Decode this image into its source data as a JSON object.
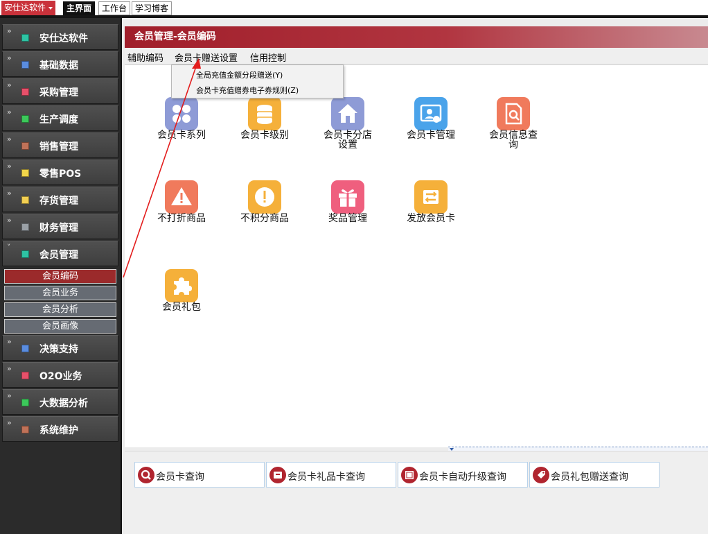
{
  "topbar": {
    "app_menu": "安仕达软件",
    "tabs": [
      "主界面",
      "工作台",
      "学习博客"
    ]
  },
  "sidebar": {
    "items": [
      {
        "label": "安仕达软件",
        "icon": "teal-square-icon",
        "color": "#2ec4a4"
      },
      {
        "label": "基础数据",
        "icon": "blue-square-icon",
        "color": "#5a8de0"
      },
      {
        "label": "采购管理",
        "icon": "pink-square-icon",
        "color": "#e8506a"
      },
      {
        "label": "生产调度",
        "icon": "green-square-icon",
        "color": "#3cc85a"
      },
      {
        "label": "销售管理",
        "icon": "brown-square-icon",
        "color": "#c07258"
      },
      {
        "label": "零售POS",
        "icon": "yellow-square-icon",
        "color": "#f2d64a"
      },
      {
        "label": "存货管理",
        "icon": "yellow-square-icon",
        "color": "#f2cf52"
      },
      {
        "label": "财务管理",
        "icon": "gray-square-icon",
        "color": "#9aa0a6"
      },
      {
        "label": "会员管理",
        "icon": "teal-square-icon",
        "color": "#2ec4a4",
        "expanded": true
      },
      {
        "label": "决策支持",
        "icon": "blue-square-icon",
        "color": "#5a8de0"
      },
      {
        "label": "O2O业务",
        "icon": "pink-square-icon",
        "color": "#e8506a"
      },
      {
        "label": "大数据分析",
        "icon": "green-square-icon",
        "color": "#3cc85a"
      },
      {
        "label": "系统维护",
        "icon": "brown-square-icon",
        "color": "#c07258"
      }
    ],
    "sub_items": [
      "会员编码",
      "会员业务",
      "会员分析",
      "会员画像"
    ]
  },
  "content": {
    "header": "会员管理-会员编码",
    "menus": [
      "辅助编码",
      "会员卡赠送设置",
      "信用控制"
    ],
    "dropdown": [
      "全局充值金额分段赠送(Y)",
      "会员卡充值赠券电子券规则(Z)"
    ],
    "tiles": [
      {
        "label_lines": [
          "会员卡系列"
        ],
        "icon": "grid-icon",
        "color": "#8e9bd6"
      },
      {
        "label_lines": [
          "会员卡级别"
        ],
        "icon": "coins-icon",
        "color": "#f5b03a"
      },
      {
        "label_lines": [
          "会员卡分店",
          "设置"
        ],
        "icon": "house-icon",
        "color": "#8e9bd6"
      },
      {
        "label_lines": [
          "会员卡管理"
        ],
        "icon": "member-card-icon",
        "color": "#4aa3ea"
      },
      {
        "label_lines": [
          "会员信息查",
          "询"
        ],
        "icon": "doc-search-icon",
        "color": "#f07a5c"
      },
      {
        "label_lines": [
          "不打折商品"
        ],
        "icon": "warning-icon",
        "color": "#f07a5c"
      },
      {
        "label_lines": [
          "不积分商品"
        ],
        "icon": "exclamation-icon",
        "color": "#f5b03a"
      },
      {
        "label_lines": [
          "奖品管理"
        ],
        "icon": "gift-icon",
        "color": "#ef5f7e"
      },
      {
        "label_lines": [
          "发放会员卡"
        ],
        "icon": "swap-icon",
        "color": "#f5b03a"
      },
      {
        "label_lines": [
          "会员礼包"
        ],
        "icon": "puzzle-icon",
        "color": "#f5b03a"
      }
    ],
    "query_buttons": [
      {
        "label": "会员卡查询",
        "icon": "search-icon"
      },
      {
        "label": "会员卡礼品卡查询",
        "icon": "gift-card-icon"
      },
      {
        "label": "会员卡自动升级查询",
        "icon": "upgrade-icon"
      },
      {
        "label": "会员礼包赠送查询",
        "icon": "tag-icon"
      }
    ],
    "accent_color": "#a01e2a"
  }
}
